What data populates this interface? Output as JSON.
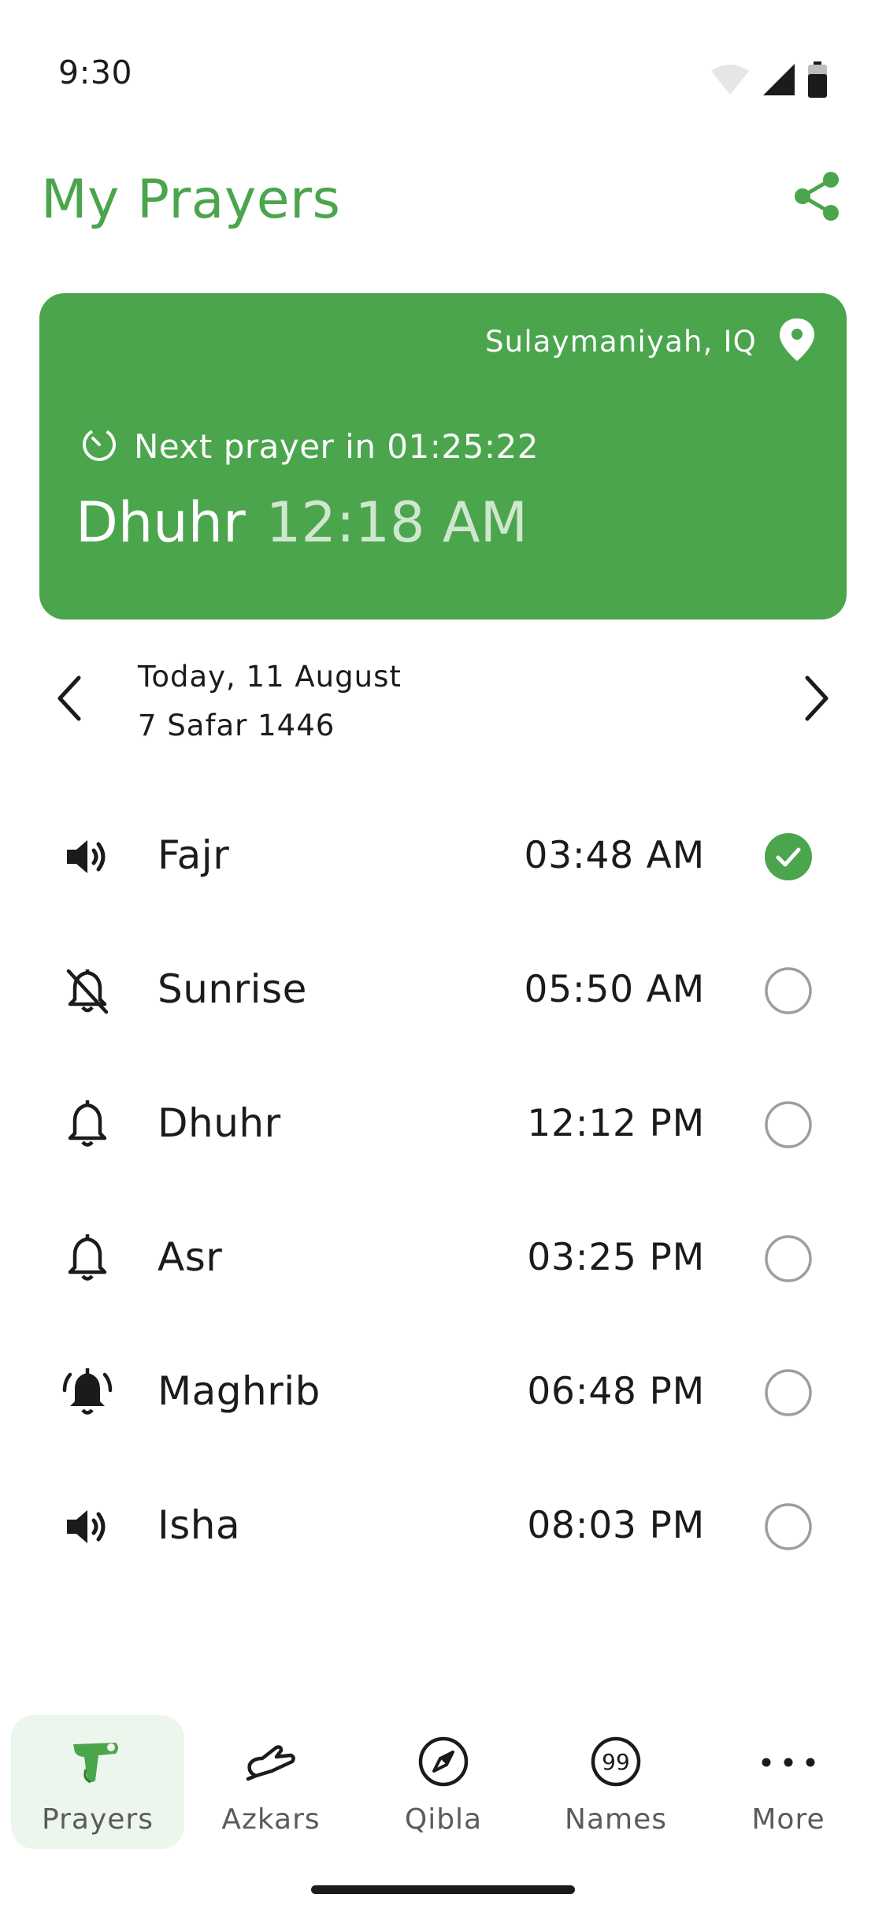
{
  "status_bar": {
    "time": "9:30",
    "icons": [
      "wifi-icon",
      "cellular-signal-icon",
      "battery-icon"
    ]
  },
  "header": {
    "title": "My Prayers",
    "share_icon": "share-icon"
  },
  "next_prayer_card": {
    "location": "Sulaymaniyah, IQ",
    "location_icon": "location-pin-icon",
    "countdown_icon": "timer-icon",
    "next_prayer_text": "Next prayer in 01:25:22",
    "prayer_name": "Dhuhr",
    "prayer_time": "12:18 AM"
  },
  "date_nav": {
    "gregorian": "Today, 11 August",
    "hijri": "7 Safar 1446",
    "prev_icon": "chevron-left-icon",
    "next_icon": "chevron-right-icon"
  },
  "prayers": [
    {
      "name": "Fajr",
      "time": "03:48 AM",
      "alert_icon": "speaker-icon",
      "completed": true
    },
    {
      "name": "Sunrise",
      "time": "05:50 AM",
      "alert_icon": "bell-off-icon",
      "completed": false
    },
    {
      "name": "Dhuhr",
      "time": "12:12 PM",
      "alert_icon": "bell-outline-icon",
      "completed": false
    },
    {
      "name": "Asr",
      "time": "03:25 PM",
      "alert_icon": "bell-outline-icon",
      "completed": false
    },
    {
      "name": "Maghrib",
      "time": "06:48 PM",
      "alert_icon": "bell-ringing-icon",
      "completed": false
    },
    {
      "name": "Isha",
      "time": "08:03 PM",
      "alert_icon": "speaker-icon",
      "completed": false
    }
  ],
  "bottom_nav": {
    "active": "Prayers",
    "items": [
      {
        "label": "Prayers",
        "icon": "prayer-mat-icon"
      },
      {
        "label": "Azkars",
        "icon": "praying-hands-icon"
      },
      {
        "label": "Qibla",
        "icon": "compass-icon"
      },
      {
        "label": "Names",
        "icon": "ninety-nine-icon"
      },
      {
        "label": "More",
        "icon": "more-horizontal-icon"
      }
    ]
  },
  "colors": {
    "accent": "#4aa54d",
    "accent_light_text": "#cfe7cf",
    "active_nav_bg": "#edf6ec",
    "unchecked_circle": "#9e9e9e",
    "text_primary": "#1b1b1b",
    "nav_label": "#5b5b5b"
  }
}
